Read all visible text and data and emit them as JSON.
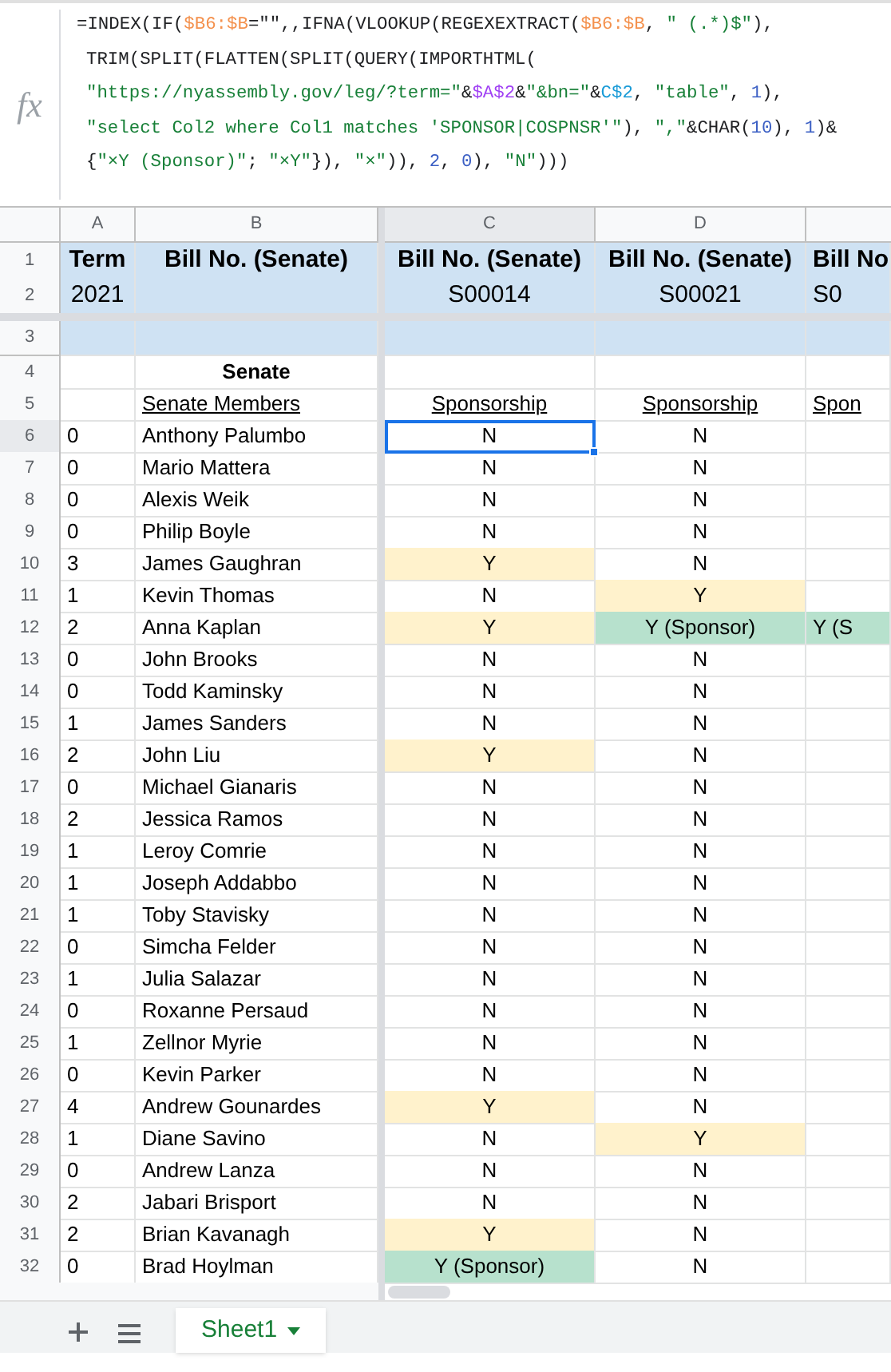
{
  "formula_bar": {
    "icon": "fx",
    "lines": [
      [
        {
          "t": "=INDEX(IF(",
          "color": "#202124"
        },
        {
          "t": "$B6:$B",
          "color": "#f4914d"
        },
        {
          "t": "=\"\",,IFNA(VLOOKUP(REGEXEXTRACT(",
          "color": "#202124"
        },
        {
          "t": "$B6:$B",
          "color": "#f4914d"
        },
        {
          "t": ", ",
          "color": "#202124"
        },
        {
          "t": "\" (.*)$\"",
          "color": "#188038"
        },
        {
          "t": "),",
          "color": "#202124"
        }
      ],
      [
        {
          "t": "TRIM(SPLIT(FLATTEN(SPLIT(QUERY(IMPORTHTML(",
          "color": "#202124"
        }
      ],
      [
        {
          "t": "\"https://nyassembly.gov/leg/?term=\"",
          "color": "#188038"
        },
        {
          "t": "&",
          "color": "#202124"
        },
        {
          "t": "$A$2",
          "color": "#a142f4"
        },
        {
          "t": "&",
          "color": "#202124"
        },
        {
          "t": "\"&bn=\"",
          "color": "#188038"
        },
        {
          "t": "&",
          "color": "#202124"
        },
        {
          "t": "C$2",
          "color": "#1a9bd7"
        },
        {
          "t": ", ",
          "color": "#202124"
        },
        {
          "t": "\"table\"",
          "color": "#188038"
        },
        {
          "t": ", ",
          "color": "#202124"
        },
        {
          "t": "1",
          "color": "#3b5fc4"
        },
        {
          "t": "),",
          "color": "#202124"
        }
      ],
      [
        {
          "t": "\"select Col2 where Col1 matches 'SPONSOR|COSPNSR'\"",
          "color": "#188038"
        },
        {
          "t": "), ",
          "color": "#202124"
        },
        {
          "t": "\",\"",
          "color": "#188038"
        },
        {
          "t": "&CHAR(",
          "color": "#202124"
        },
        {
          "t": "10",
          "color": "#3b5fc4"
        },
        {
          "t": "), ",
          "color": "#202124"
        },
        {
          "t": "1",
          "color": "#3b5fc4"
        },
        {
          "t": ")&",
          "color": "#202124"
        }
      ],
      [
        {
          "t": "{",
          "color": "#202124"
        },
        {
          "t": "\"×Y (Sponsor)\"",
          "color": "#188038"
        },
        {
          "t": "; ",
          "color": "#202124"
        },
        {
          "t": "\"×Y\"",
          "color": "#188038"
        },
        {
          "t": "}), ",
          "color": "#202124"
        },
        {
          "t": "\"×\"",
          "color": "#188038"
        },
        {
          "t": ")), ",
          "color": "#202124"
        },
        {
          "t": "2",
          "color": "#3b5fc4"
        },
        {
          "t": ", ",
          "color": "#202124"
        },
        {
          "t": "0",
          "color": "#3b5fc4"
        },
        {
          "t": "), ",
          "color": "#202124"
        },
        {
          "t": "\"N\"",
          "color": "#188038"
        },
        {
          "t": ")))",
          "color": "#202124"
        }
      ]
    ]
  },
  "column_headers": [
    {
      "label": "A",
      "selected": false
    },
    {
      "label": "B",
      "selected": false
    },
    {
      "label": "C",
      "selected": true
    },
    {
      "label": "D",
      "selected": false
    }
  ],
  "header_rows": [
    {
      "n": "1",
      "cells": [
        "Term",
        "Bill No. (Senate)",
        "Bill No. (Senate)",
        "Bill No. (Senate)",
        "Bill No"
      ]
    },
    {
      "n": "2",
      "cells": [
        "2021",
        "",
        "S00014",
        "S00021",
        "S0"
      ]
    }
  ],
  "row_3": {
    "n": "3"
  },
  "row_4": {
    "n": "4",
    "title": "Senate"
  },
  "row_5": {
    "n": "5",
    "labels": [
      "Senate Members",
      "Sponsorship",
      "Sponsorship",
      "Spon"
    ]
  },
  "rows": [
    {
      "n": "6",
      "a": "0",
      "b": "Anthony Palumbo",
      "selected": true,
      "cells": [
        {
          "text": "N",
          "selected": true
        },
        {
          "text": "N",
          "selected": false
        }
      ]
    },
    {
      "n": "7",
      "a": "0",
      "b": "Mario Mattera",
      "selected": false,
      "cells": [
        {
          "text": "N",
          "selected": false
        },
        {
          "text": "N",
          "selected": false
        }
      ]
    },
    {
      "n": "8",
      "a": "0",
      "b": "Alexis Weik",
      "selected": false,
      "cells": [
        {
          "text": "N",
          "selected": false
        },
        {
          "text": "N",
          "selected": false
        }
      ]
    },
    {
      "n": "9",
      "a": "0",
      "b": "Philip Boyle",
      "selected": false,
      "cells": [
        {
          "text": "N",
          "selected": false
        },
        {
          "text": "N",
          "selected": false
        }
      ]
    },
    {
      "n": "10",
      "a": "3",
      "b": "James Gaughran",
      "selected": false,
      "cells": [
        {
          "text": "Y",
          "color": "#fff2cc",
          "selected": false
        },
        {
          "text": "N",
          "selected": false
        }
      ]
    },
    {
      "n": "11",
      "a": "1",
      "b": "Kevin Thomas",
      "selected": false,
      "cells": [
        {
          "text": "N",
          "selected": false
        },
        {
          "text": "Y",
          "color": "#fff2cc",
          "selected": false
        }
      ]
    },
    {
      "n": "12",
      "a": "2",
      "b": "Anna Kaplan",
      "selected": false,
      "cells": [
        {
          "text": "Y",
          "color": "#fff2cc",
          "selected": false
        },
        {
          "text": "Y (Sponsor)",
          "color": "#b7e1cd",
          "selected": false
        },
        {
          "text": "Y (S",
          "color": "#b7e1cd",
          "selected": false
        }
      ]
    },
    {
      "n": "13",
      "a": "0",
      "b": "John Brooks",
      "selected": false,
      "cells": [
        {
          "text": "N",
          "selected": false
        },
        {
          "text": "N",
          "selected": false
        }
      ]
    },
    {
      "n": "14",
      "a": "0",
      "b": "Todd Kaminsky",
      "selected": false,
      "cells": [
        {
          "text": "N",
          "selected": false
        },
        {
          "text": "N",
          "selected": false
        }
      ]
    },
    {
      "n": "15",
      "a": "1",
      "b": "James Sanders",
      "selected": false,
      "cells": [
        {
          "text": "N",
          "selected": false
        },
        {
          "text": "N",
          "selected": false
        }
      ]
    },
    {
      "n": "16",
      "a": "2",
      "b": "John Liu",
      "selected": false,
      "cells": [
        {
          "text": "Y",
          "color": "#fff2cc",
          "selected": false
        },
        {
          "text": "N",
          "selected": false
        }
      ]
    },
    {
      "n": "17",
      "a": "0",
      "b": "Michael Gianaris",
      "selected": false,
      "cells": [
        {
          "text": "N",
          "selected": false
        },
        {
          "text": "N",
          "selected": false
        }
      ]
    },
    {
      "n": "18",
      "a": "2",
      "b": "Jessica Ramos",
      "selected": false,
      "cells": [
        {
          "text": "N",
          "selected": false
        },
        {
          "text": "N",
          "selected": false
        }
      ]
    },
    {
      "n": "19",
      "a": "1",
      "b": "Leroy Comrie",
      "selected": false,
      "cells": [
        {
          "text": "N",
          "selected": false
        },
        {
          "text": "N",
          "selected": false
        }
      ]
    },
    {
      "n": "20",
      "a": "1",
      "b": "Joseph Addabbo",
      "selected": false,
      "cells": [
        {
          "text": "N",
          "selected": false
        },
        {
          "text": "N",
          "selected": false
        }
      ]
    },
    {
      "n": "21",
      "a": "1",
      "b": "Toby Stavisky",
      "selected": false,
      "cells": [
        {
          "text": "N",
          "selected": false
        },
        {
          "text": "N",
          "selected": false
        }
      ]
    },
    {
      "n": "22",
      "a": "0",
      "b": "Simcha Felder",
      "selected": false,
      "cells": [
        {
          "text": "N",
          "selected": false
        },
        {
          "text": "N",
          "selected": false
        }
      ]
    },
    {
      "n": "23",
      "a": "1",
      "b": "Julia Salazar",
      "selected": false,
      "cells": [
        {
          "text": "N",
          "selected": false
        },
        {
          "text": "N",
          "selected": false
        }
      ]
    },
    {
      "n": "24",
      "a": "0",
      "b": "Roxanne Persaud",
      "selected": false,
      "cells": [
        {
          "text": "N",
          "selected": false
        },
        {
          "text": "N",
          "selected": false
        }
      ]
    },
    {
      "n": "25",
      "a": "1",
      "b": "Zellnor Myrie",
      "selected": false,
      "cells": [
        {
          "text": "N",
          "selected": false
        },
        {
          "text": "N",
          "selected": false
        }
      ]
    },
    {
      "n": "26",
      "a": "0",
      "b": "Kevin Parker",
      "selected": false,
      "cells": [
        {
          "text": "N",
          "selected": false
        },
        {
          "text": "N",
          "selected": false
        }
      ]
    },
    {
      "n": "27",
      "a": "4",
      "b": "Andrew Gounardes",
      "selected": false,
      "cells": [
        {
          "text": "Y",
          "color": "#fff2cc",
          "selected": false
        },
        {
          "text": "N",
          "selected": false
        }
      ]
    },
    {
      "n": "28",
      "a": "1",
      "b": "Diane Savino",
      "selected": false,
      "cells": [
        {
          "text": "N",
          "selected": false
        },
        {
          "text": "Y",
          "color": "#fff2cc",
          "selected": false
        }
      ]
    },
    {
      "n": "29",
      "a": "0",
      "b": "Andrew Lanza",
      "selected": false,
      "cells": [
        {
          "text": "N",
          "selected": false
        },
        {
          "text": "N",
          "selected": false
        }
      ]
    },
    {
      "n": "30",
      "a": "2",
      "b": "Jabari Brisport",
      "selected": false,
      "cells": [
        {
          "text": "N",
          "selected": false
        },
        {
          "text": "N",
          "selected": false
        }
      ]
    },
    {
      "n": "31",
      "a": "2",
      "b": "Brian Kavanagh",
      "selected": false,
      "cells": [
        {
          "text": "Y",
          "color": "#fff2cc",
          "selected": false
        },
        {
          "text": "N",
          "selected": false
        }
      ]
    },
    {
      "n": "32",
      "a": "0",
      "b": "Brad Hoylman",
      "selected": false,
      "cells": [
        {
          "text": "Y (Sponsor)",
          "color": "#b7e1cd",
          "selected": false
        },
        {
          "text": "N",
          "selected": false
        }
      ]
    }
  ],
  "sheet_tabs": [
    {
      "label": "Sheet1",
      "selected": true
    }
  ]
}
